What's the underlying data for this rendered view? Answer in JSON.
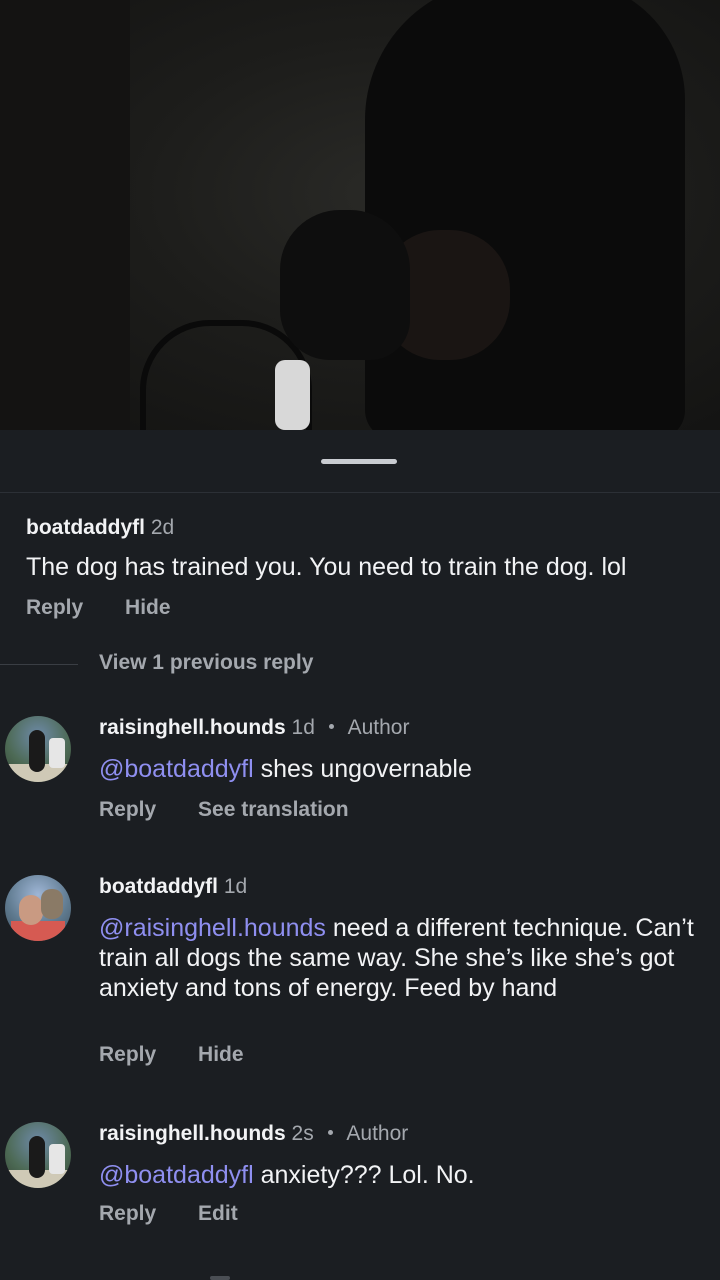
{
  "comments": [
    {
      "username": "boatdaddyfl",
      "time": "2d",
      "text": "The dog has trained you.  You need to train the dog. lol",
      "actions": [
        "Reply",
        "Hide"
      ]
    },
    {
      "view_previous": "View 1 previous reply"
    },
    {
      "username": "raisinghell.hounds",
      "time": "1d",
      "badge": "Author",
      "mention": "@boatdaddyfl",
      "text": " shes ungovernable",
      "actions": [
        "Reply",
        "See translation"
      ]
    },
    {
      "username": "boatdaddyfl",
      "time": "1d",
      "mention": "@raisinghell.hounds",
      "text": "  need a different technique.  Can’t train all dogs the same way.  She she’s like she’s got anxiety and tons of energy.  Feed by hand",
      "actions": [
        "Reply",
        "Hide"
      ]
    },
    {
      "username": "raisinghell.hounds",
      "time": "2s",
      "badge": "Author",
      "mention": "@boatdaddyfl",
      "text": " anxiety??? Lol. No.",
      "actions": [
        "Reply",
        "Edit"
      ]
    }
  ],
  "colors": {
    "background": "#1b1e22",
    "text": "#f2f3f5",
    "muted": "#a4a8ae",
    "mention": "#8f8ff0"
  }
}
